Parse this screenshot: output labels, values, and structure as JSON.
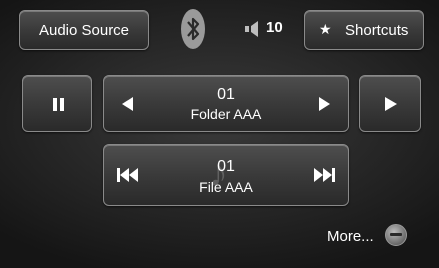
{
  "header": {
    "audio_source_label": "Audio Source",
    "bluetooth_icon": "bluetooth-icon",
    "volume_icon": "volume-icon",
    "volume_value": "10",
    "shortcuts_label": "Shortcuts",
    "shortcuts_icon": "star-icon"
  },
  "folder": {
    "number": "01",
    "name": "Folder AAA"
  },
  "file": {
    "number": "01",
    "name": "File AAA"
  },
  "more": {
    "label": "More..."
  },
  "colors": {
    "background": "#262626",
    "button": "#3a3a3a",
    "border": "#8a8a8a",
    "text": "#ffffff"
  }
}
